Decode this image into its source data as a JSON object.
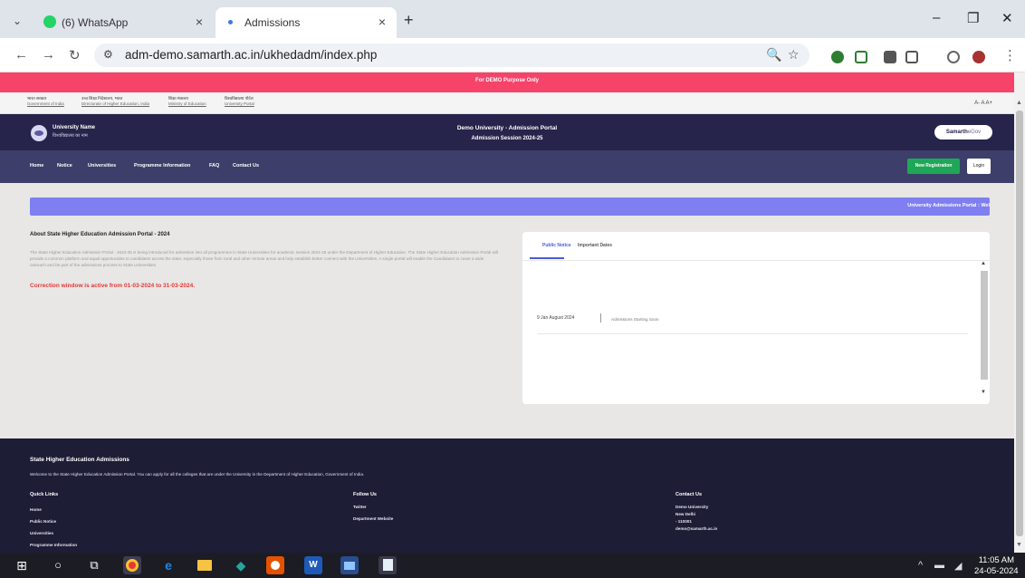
{
  "browser": {
    "tabs": [
      {
        "title": "(6) WhatsApp",
        "close": "×"
      },
      {
        "title": "Admissions",
        "close": "×"
      }
    ],
    "new_tab": "+",
    "url": "adm-demo.samarth.ac.in/ukhedadm/index.php",
    "window_controls": {
      "minimize": "–",
      "restore": "❐",
      "close": "✕"
    }
  },
  "page": {
    "demo_banner": "For DEMO Purpose Only",
    "gov_links": [
      {
        "line1": "भारत सरकार",
        "line2": "Government of India"
      },
      {
        "line1": "उच्च शिक्षा निदेशालय, भारत",
        "line2": "Directorate of Higher Education, India"
      },
      {
        "line1": "शिक्षा मंत्रालय",
        "line2": "Ministry of Education"
      },
      {
        "line1": "विश्वविद्यालय पोर्टल",
        "line2": "University Portal"
      }
    ],
    "font_controls": "A- A A+",
    "header": {
      "uni_name": "University Name",
      "uni_name_hi": "विश्वविद्यालय का नाम",
      "portal_title": "Demo University - Admission Portal",
      "session": "Admission Session 2024-25",
      "brand_main": "Samarth",
      "brand_sub": "eGov"
    },
    "nav": {
      "items": [
        "Home",
        "Notice",
        "Universities",
        "Programme Information",
        "FAQ",
        "Contact Us"
      ],
      "register": "New Registration",
      "login": "Login"
    },
    "ticker": "University Admissions Portal : Wel",
    "about": {
      "heading": "About State Higher Education Admission Portal - 2024",
      "text": "The State Higher Education Admission Portal - 2024-25 is being introduced for admission into all programmes in State Universities for academic session 2024-25 under the Department of Higher Education. The State Higher Education Admission Portal will provide a common platform and equal opportunities to candidates across the state, especially those from rural and other remote areas and help establish better connect with the Universities. A single portal will enable the Candidates to cover a wide outreach and be part of the admissions process to State Universities.",
      "correction": "Correction window is active from 01-03-2024 to 31-03-2024."
    },
    "notice_card": {
      "tabs": [
        "Public Notice",
        "Important Dates"
      ],
      "items": [
        {
          "date": "9 Jan August 2024",
          "title": "Admissions Starting Soon"
        }
      ]
    },
    "footer": {
      "title": "State Higher Education Admissions",
      "desc": "Welcome to the State Higher Education Admission Portal. You can apply for all the colleges that are under the University in the Department of Higher Education, Government of India.",
      "quick_links_heading": "Quick Links",
      "quick_links": [
        "Home",
        "Public Notice",
        "Universities",
        "Programme Information"
      ],
      "follow_heading": "Follow Us",
      "follow_links": [
        "Twitter",
        "Department Website"
      ],
      "contact_heading": "Contact Us",
      "contact_lines": [
        "Demo University",
        "New Delhi",
        "- 110001",
        "demo@samarth.ac.in"
      ]
    }
  },
  "taskbar": {
    "time": "11:05 AM",
    "date": "24-05-2024"
  }
}
